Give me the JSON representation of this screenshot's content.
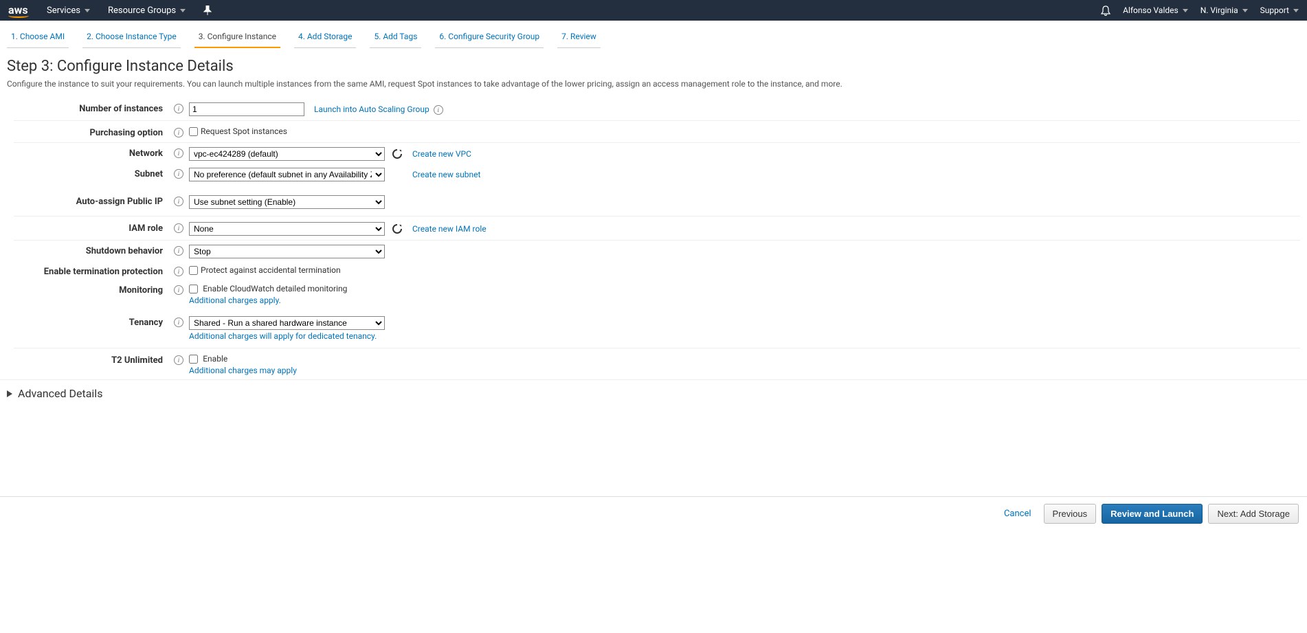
{
  "header": {
    "logo": "aws",
    "services": "Services",
    "resource_groups": "Resource Groups",
    "user": "Alfonso Valdes",
    "region": "N. Virginia",
    "support": "Support"
  },
  "tabs": {
    "t1": "1. Choose AMI",
    "t2": "2. Choose Instance Type",
    "t3": "3. Configure Instance",
    "t4": "4. Add Storage",
    "t5": "5. Add Tags",
    "t6": "6. Configure Security Group",
    "t7": "7. Review"
  },
  "title": "Step 3: Configure Instance Details",
  "subtitle": "Configure the instance to suit your requirements. You can launch multiple instances from the same AMI, request Spot instances to take advantage of the lower pricing, assign an access management role to the instance, and more.",
  "labels": {
    "num_instances": "Number of instances",
    "purchasing": "Purchasing option",
    "network": "Network",
    "subnet": "Subnet",
    "public_ip": "Auto-assign Public IP",
    "iam": "IAM role",
    "shutdown": "Shutdown behavior",
    "termination": "Enable termination protection",
    "monitoring": "Monitoring",
    "tenancy": "Tenancy",
    "t2": "T2 Unlimited"
  },
  "values": {
    "num_instances": "1",
    "asg_link": "Launch into Auto Scaling Group",
    "spot_text": "Request Spot instances",
    "network": "vpc-ec424289 (default)",
    "create_vpc": "Create new VPC",
    "subnet": "No preference (default subnet in any Availability Zone)",
    "create_subnet": "Create new subnet",
    "public_ip": "Use subnet setting (Enable)",
    "iam": "None",
    "create_iam": "Create new IAM role",
    "shutdown": "Stop",
    "termination_text": "Protect against accidental termination",
    "monitoring_text": "Enable CloudWatch detailed monitoring",
    "monitoring_note": "Additional charges apply.",
    "tenancy": "Shared - Run a shared hardware instance",
    "tenancy_note": "Additional charges will apply for dedicated tenancy.",
    "t2_text": "Enable",
    "t2_note": "Additional charges may apply"
  },
  "advanced": "Advanced Details",
  "footer": {
    "cancel": "Cancel",
    "previous": "Previous",
    "review": "Review and Launch",
    "next": "Next: Add Storage"
  }
}
